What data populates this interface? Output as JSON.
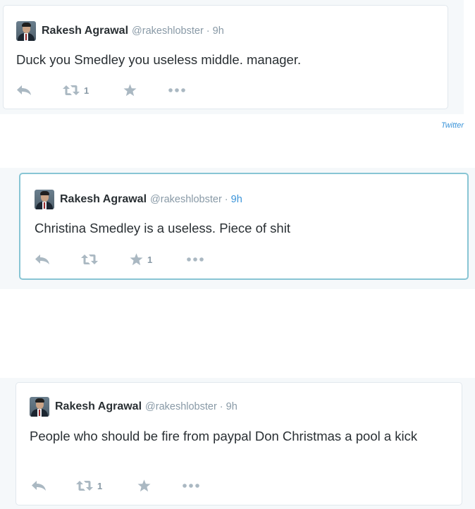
{
  "tweets": [
    {
      "name": "Rakesh Agrawal",
      "handle": "@rakeshlobster",
      "separator": "·",
      "time": "9h",
      "text": "Duck you Smedley you useless middle. manager.",
      "retweets": "1",
      "favorites": "",
      "highlighted": false
    },
    {
      "name": "Rakesh Agrawal",
      "handle": "@rakeshlobster",
      "separator": "·",
      "time": "9h",
      "text": "Christina Smedley is a useless. Piece of shit",
      "retweets": "",
      "favorites": "1",
      "highlighted": true
    },
    {
      "name": "Rakesh Agrawal",
      "handle": "@rakeshlobster",
      "separator": "·",
      "time": "9h",
      "text": "People who should be fire from paypal Don Christmas a pool a kick",
      "retweets": "1",
      "favorites": "",
      "highlighted": false
    }
  ],
  "source_label": "Twitter",
  "colors": {
    "icon_gray": "#aab8c2",
    "link_blue": "#3b94d9",
    "highlight_border": "#88c5d4"
  },
  "icons": [
    "reply-icon",
    "retweet-icon",
    "favorite-star-icon",
    "more-options-icon"
  ]
}
